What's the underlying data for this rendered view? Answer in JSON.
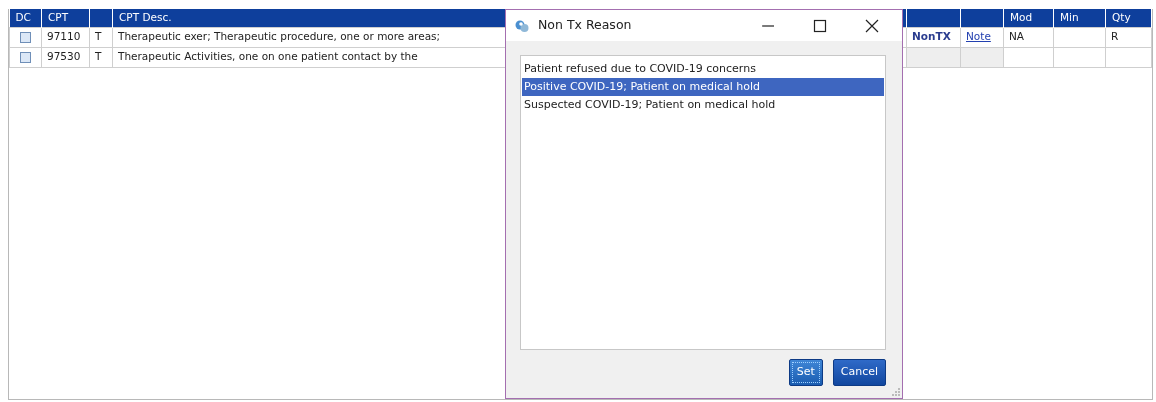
{
  "table": {
    "columns": {
      "dc": "DC",
      "cpt": "CPT",
      "desc": "CPT Desc.",
      "mod": "Mod",
      "min": "Min",
      "qty": "Qty"
    },
    "rows": [
      {
        "checked": false,
        "cpt": "97110",
        "type": "T",
        "desc": "Therapeutic exer; Therapeutic procedure, one or more areas;",
        "nontx": "NonTX",
        "note": "Note",
        "mod": "NA",
        "qty": "R"
      },
      {
        "checked": false,
        "cpt": "97530",
        "type": "T",
        "desc": "Therapeutic Activities, one on one patient contact by the"
      }
    ]
  },
  "dialog": {
    "title": "Non Tx Reason",
    "items": [
      {
        "label": "Patient refused due to COVID-19 concerns",
        "selected": false
      },
      {
        "label": "Positive COVID-19; Patient on medical hold",
        "selected": true
      },
      {
        "label": "Suspected COVID-19; Patient on medical hold",
        "selected": false
      }
    ],
    "buttons": [
      {
        "label": "Set",
        "focused": true
      },
      {
        "label": "Cancel",
        "focused": false
      }
    ]
  }
}
